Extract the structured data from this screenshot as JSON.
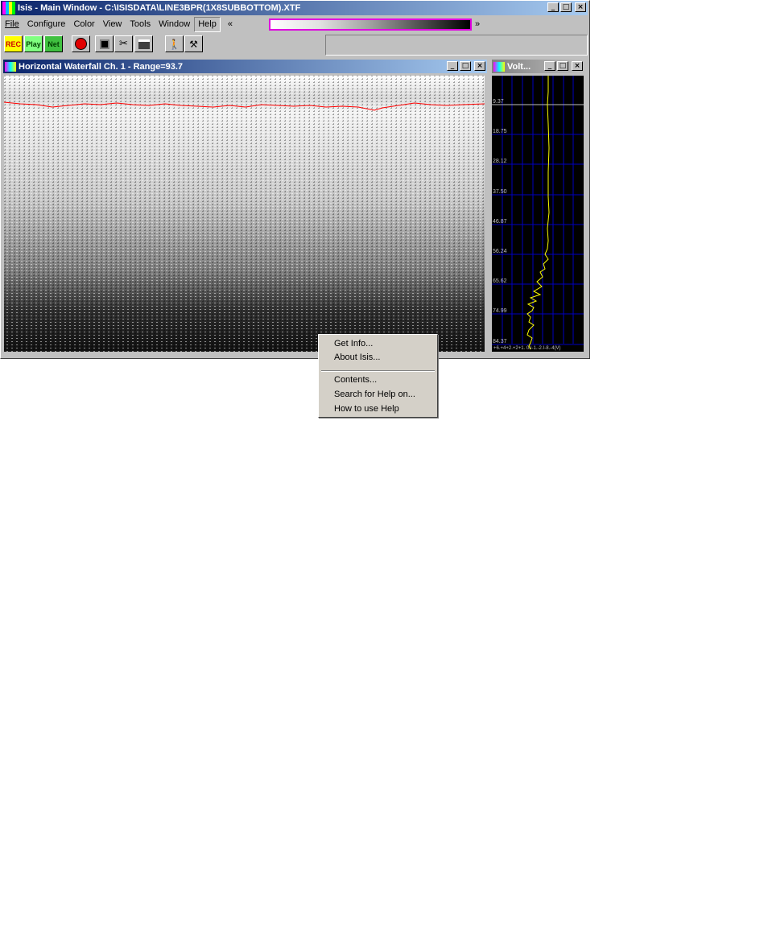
{
  "main_window": {
    "title": "Isis - Main Window - C:\\ISISDATA\\LINE3BPR(1X8SUBBOTTOM).XTF",
    "app_icon": "isis-app-icon",
    "window_controls": [
      "_",
      "□",
      "×"
    ]
  },
  "menu": {
    "file": "File",
    "configure": "Configure",
    "color": "Color",
    "view": "View",
    "tools": "Tools",
    "window": "Window",
    "help": "Help",
    "palette_left": "«",
    "palette_right": "»"
  },
  "toolbar": {
    "rec": "REC",
    "play": "Play",
    "net": "Net",
    "icons": [
      "record-icon",
      "playback-icon",
      "network-icon",
      "stop-icon",
      "save-icon",
      "cut-icon",
      "print-icon",
      "walk-icon",
      "tools-icon"
    ]
  },
  "help_menu": {
    "get_info": "Get Info...",
    "about": "About Isis...",
    "contents": "Contents...",
    "search": "Search for Help on...",
    "how_to": "How to use Help"
  },
  "waterfall_window": {
    "title": "Horizontal Waterfall Ch. 1 - Range=93.7"
  },
  "volt_window": {
    "title": "Volt...",
    "y_ticks": [
      "9.37",
      "18.75",
      "28.12",
      "37.50",
      "46.87",
      "56.24",
      "65.62",
      "74.99",
      "84.37"
    ],
    "x_axis_label": "+6.+4+2.+2+1. 0.I-1.-2.I-8.-4(V)"
  },
  "colors": {
    "title_active": "#0a246a",
    "bottom_trace": "#ff0000",
    "volt_trace": "#ffff00",
    "volt_grid": "#0000c0"
  }
}
